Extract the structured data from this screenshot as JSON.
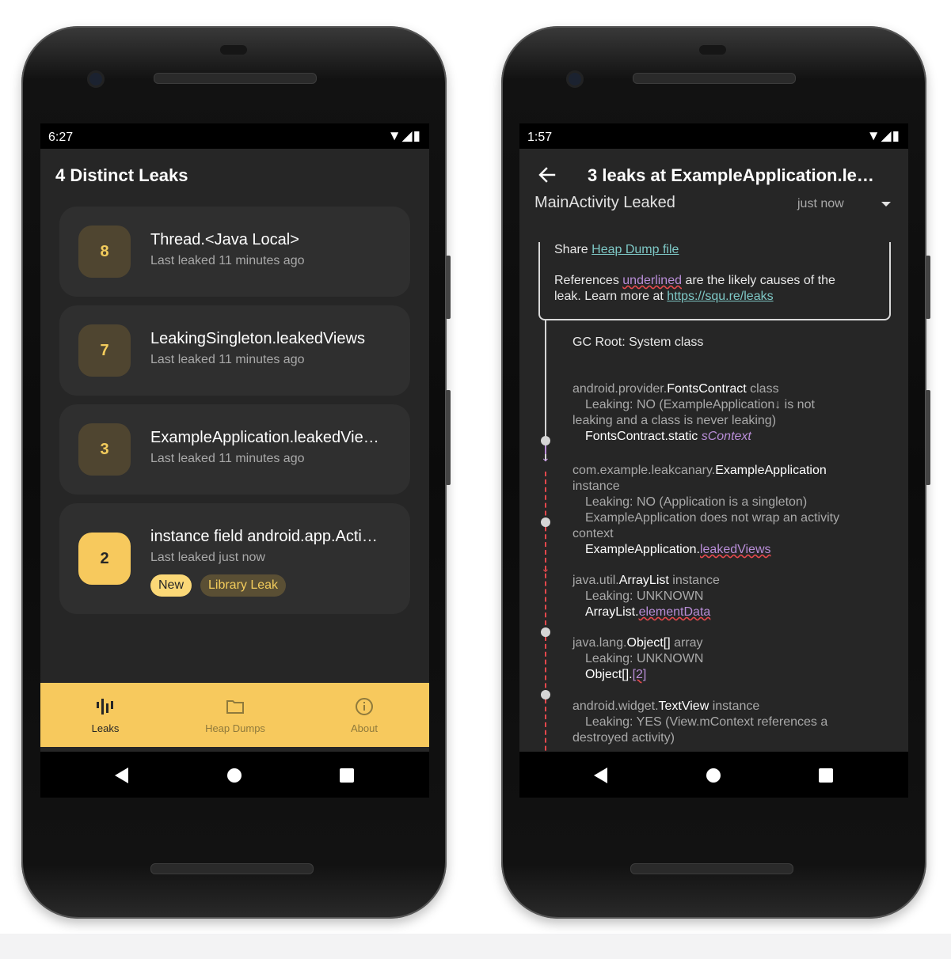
{
  "left_screen": {
    "status_time": "6:27",
    "status_icons": "▼◢▮",
    "title": "4 Distinct Leaks",
    "leaks": [
      {
        "count": "8",
        "title": "Thread.<Java Local>",
        "subtitle": "Last leaked 11 minutes ago"
      },
      {
        "count": "7",
        "title": "LeakingSingleton.leakedViews",
        "subtitle": "Last leaked 11 minutes ago"
      },
      {
        "count": "3",
        "title": "ExampleApplication.leakedVie…",
        "subtitle": "Last leaked 11 minutes ago"
      },
      {
        "count": "2",
        "title": "instance field android.app.Acti…",
        "subtitle": "Last leaked just now",
        "chips": [
          "New",
          "Library Leak"
        ]
      }
    ],
    "bottom_nav": [
      {
        "label": "Leaks",
        "icon": "leaks-icon",
        "active": true
      },
      {
        "label": "Heap Dumps",
        "icon": "folder-icon",
        "active": false
      },
      {
        "label": "About",
        "icon": "info-icon",
        "active": false
      }
    ]
  },
  "right_screen": {
    "status_time": "1:57",
    "status_icons": "▼◢▮",
    "title": "3 leaks at ExampleApplication.le…",
    "leak_header": "MainActivity Leaked",
    "leak_time": "just now",
    "share_prefix": "Share ",
    "share_link": "Heap Dump file",
    "refs_prefix": "References ",
    "refs_underlined": "underlined",
    "refs_suffix": " are the likely causes of the",
    "refs_line2_prefix": "leak. Learn more at ",
    "refs_link": "https://squ.re/leaks",
    "gc_root": "GC Root: System class",
    "trace": {
      "n1_pkg": "android.provider.",
      "n1_cls": "FontsContract",
      "n1_kind": " class",
      "n1_leak_a": "Leaking: NO (ExampleApplication↓ is not",
      "n1_leak_b": "leaking and a class is never leaking)",
      "n1_ref_cls": "FontsContract.static ",
      "n1_ref_field": "sContext",
      "n2_pkg": "com.example.leakcanary.",
      "n2_cls": "ExampleApplication",
      "n2_kind": "instance",
      "n2_leak": "Leaking: NO (Application is a singleton)",
      "n2_note_a": "ExampleApplication does not wrap an activity",
      "n2_note_b": "context",
      "n2_ref_cls": "ExampleApplication.",
      "n2_ref_field": "leakedViews",
      "n3_pkg": "java.util.",
      "n3_cls": "ArrayList",
      "n3_kind": " instance",
      "n3_leak": "Leaking: UNKNOWN",
      "n3_ref_cls": "ArrayList.",
      "n3_ref_field": "elementData",
      "n4_pkg": "java.lang.",
      "n4_cls": "Object[]",
      "n4_kind": " array",
      "n4_leak": "Leaking: UNKNOWN",
      "n4_ref_cls": "Object[].",
      "n4_ref_field": "[2]",
      "n5_pkg": "android.widget.",
      "n5_cls": "TextView",
      "n5_kind": " instance",
      "n5_leak_a": "Leaking: YES (View.mContext references a",
      "n5_leak_b": "destroyed activity)"
    }
  },
  "colors": {
    "accent": "#f7c95d",
    "screen_bg": "#262626",
    "card_bg": "#2f2f2f",
    "link_teal": "#7ec8c6",
    "link_purple": "#b98ed8",
    "leak_red": "#e4484c"
  }
}
